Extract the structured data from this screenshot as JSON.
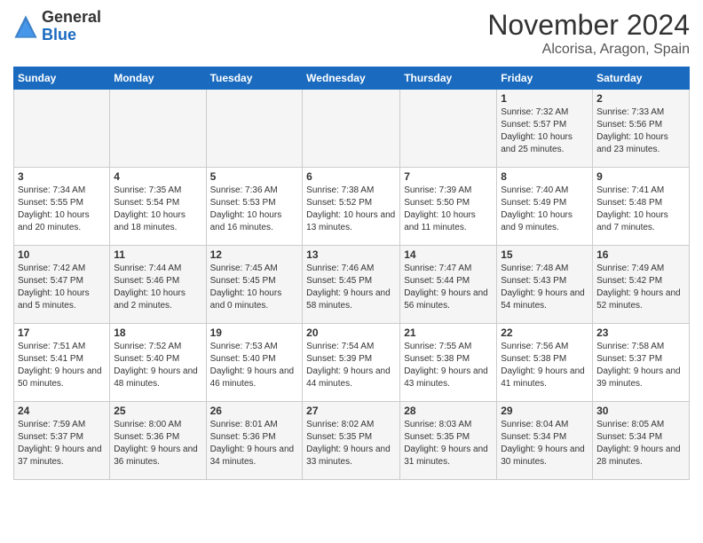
{
  "header": {
    "logo": {
      "general": "General",
      "blue": "Blue"
    },
    "month": "November 2024",
    "location": "Alcorisa, Aragon, Spain"
  },
  "weekdays": [
    "Sunday",
    "Monday",
    "Tuesday",
    "Wednesday",
    "Thursday",
    "Friday",
    "Saturday"
  ],
  "weeks": [
    [
      {
        "day": "",
        "info": ""
      },
      {
        "day": "",
        "info": ""
      },
      {
        "day": "",
        "info": ""
      },
      {
        "day": "",
        "info": ""
      },
      {
        "day": "",
        "info": ""
      },
      {
        "day": "1",
        "info": "Sunrise: 7:32 AM\nSunset: 5:57 PM\nDaylight: 10 hours and 25 minutes."
      },
      {
        "day": "2",
        "info": "Sunrise: 7:33 AM\nSunset: 5:56 PM\nDaylight: 10 hours and 23 minutes."
      }
    ],
    [
      {
        "day": "3",
        "info": "Sunrise: 7:34 AM\nSunset: 5:55 PM\nDaylight: 10 hours and 20 minutes."
      },
      {
        "day": "4",
        "info": "Sunrise: 7:35 AM\nSunset: 5:54 PM\nDaylight: 10 hours and 18 minutes."
      },
      {
        "day": "5",
        "info": "Sunrise: 7:36 AM\nSunset: 5:53 PM\nDaylight: 10 hours and 16 minutes."
      },
      {
        "day": "6",
        "info": "Sunrise: 7:38 AM\nSunset: 5:52 PM\nDaylight: 10 hours and 13 minutes."
      },
      {
        "day": "7",
        "info": "Sunrise: 7:39 AM\nSunset: 5:50 PM\nDaylight: 10 hours and 11 minutes."
      },
      {
        "day": "8",
        "info": "Sunrise: 7:40 AM\nSunset: 5:49 PM\nDaylight: 10 hours and 9 minutes."
      },
      {
        "day": "9",
        "info": "Sunrise: 7:41 AM\nSunset: 5:48 PM\nDaylight: 10 hours and 7 minutes."
      }
    ],
    [
      {
        "day": "10",
        "info": "Sunrise: 7:42 AM\nSunset: 5:47 PM\nDaylight: 10 hours and 5 minutes."
      },
      {
        "day": "11",
        "info": "Sunrise: 7:44 AM\nSunset: 5:46 PM\nDaylight: 10 hours and 2 minutes."
      },
      {
        "day": "12",
        "info": "Sunrise: 7:45 AM\nSunset: 5:45 PM\nDaylight: 10 hours and 0 minutes."
      },
      {
        "day": "13",
        "info": "Sunrise: 7:46 AM\nSunset: 5:45 PM\nDaylight: 9 hours and 58 minutes."
      },
      {
        "day": "14",
        "info": "Sunrise: 7:47 AM\nSunset: 5:44 PM\nDaylight: 9 hours and 56 minutes."
      },
      {
        "day": "15",
        "info": "Sunrise: 7:48 AM\nSunset: 5:43 PM\nDaylight: 9 hours and 54 minutes."
      },
      {
        "day": "16",
        "info": "Sunrise: 7:49 AM\nSunset: 5:42 PM\nDaylight: 9 hours and 52 minutes."
      }
    ],
    [
      {
        "day": "17",
        "info": "Sunrise: 7:51 AM\nSunset: 5:41 PM\nDaylight: 9 hours and 50 minutes."
      },
      {
        "day": "18",
        "info": "Sunrise: 7:52 AM\nSunset: 5:40 PM\nDaylight: 9 hours and 48 minutes."
      },
      {
        "day": "19",
        "info": "Sunrise: 7:53 AM\nSunset: 5:40 PM\nDaylight: 9 hours and 46 minutes."
      },
      {
        "day": "20",
        "info": "Sunrise: 7:54 AM\nSunset: 5:39 PM\nDaylight: 9 hours and 44 minutes."
      },
      {
        "day": "21",
        "info": "Sunrise: 7:55 AM\nSunset: 5:38 PM\nDaylight: 9 hours and 43 minutes."
      },
      {
        "day": "22",
        "info": "Sunrise: 7:56 AM\nSunset: 5:38 PM\nDaylight: 9 hours and 41 minutes."
      },
      {
        "day": "23",
        "info": "Sunrise: 7:58 AM\nSunset: 5:37 PM\nDaylight: 9 hours and 39 minutes."
      }
    ],
    [
      {
        "day": "24",
        "info": "Sunrise: 7:59 AM\nSunset: 5:37 PM\nDaylight: 9 hours and 37 minutes."
      },
      {
        "day": "25",
        "info": "Sunrise: 8:00 AM\nSunset: 5:36 PM\nDaylight: 9 hours and 36 minutes."
      },
      {
        "day": "26",
        "info": "Sunrise: 8:01 AM\nSunset: 5:36 PM\nDaylight: 9 hours and 34 minutes."
      },
      {
        "day": "27",
        "info": "Sunrise: 8:02 AM\nSunset: 5:35 PM\nDaylight: 9 hours and 33 minutes."
      },
      {
        "day": "28",
        "info": "Sunrise: 8:03 AM\nSunset: 5:35 PM\nDaylight: 9 hours and 31 minutes."
      },
      {
        "day": "29",
        "info": "Sunrise: 8:04 AM\nSunset: 5:34 PM\nDaylight: 9 hours and 30 minutes."
      },
      {
        "day": "30",
        "info": "Sunrise: 8:05 AM\nSunset: 5:34 PM\nDaylight: 9 hours and 28 minutes."
      }
    ]
  ]
}
